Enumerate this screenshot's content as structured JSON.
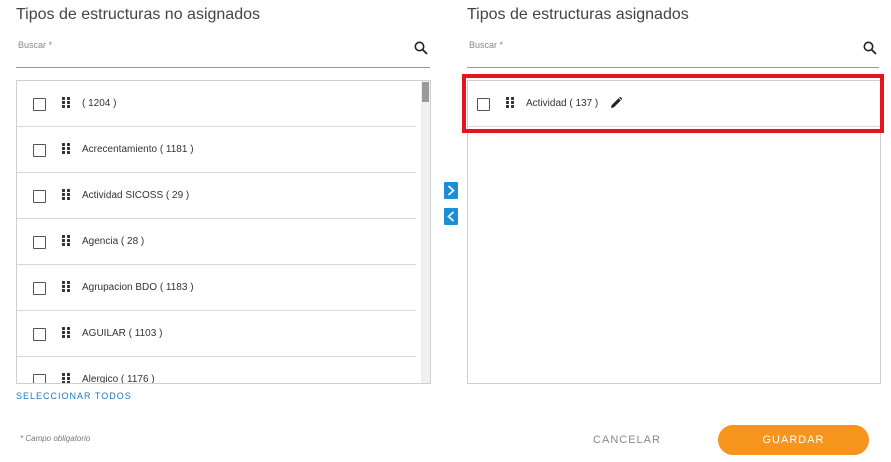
{
  "left_panel": {
    "title": "Tipos de estructuras no asignados",
    "search_placeholder": "Buscar *",
    "items": [
      {
        "label": "( 1204 )"
      },
      {
        "label": "Acrecentamiento ( 1181 )"
      },
      {
        "label": "Actividad SICOSS ( 29 )"
      },
      {
        "label": "Agencia ( 28 )"
      },
      {
        "label": "Agrupacion BDO ( 1183 )"
      },
      {
        "label": "AGUILAR ( 1103 )"
      },
      {
        "label": "Alergico ( 1176 )"
      }
    ],
    "select_all_label": "SELECCIONAR TODOS"
  },
  "right_panel": {
    "title": "Tipos de estructuras asignados",
    "search_placeholder": "Buscar *",
    "items": [
      {
        "label": "Actividad ( 137 )"
      }
    ]
  },
  "footer": {
    "required_note": "* Campo obligatorio",
    "cancel_label": "CANCELAR",
    "save_label": "GUARDAR"
  },
  "colors": {
    "accent_blue": "#1a8fd6",
    "save_orange": "#f7941d",
    "highlight_red": "#e8141c"
  },
  "icons": [
    "search-icon",
    "drag-handle-icon",
    "edit-pencil-icon",
    "chevron-right-icon",
    "chevron-left-icon"
  ]
}
